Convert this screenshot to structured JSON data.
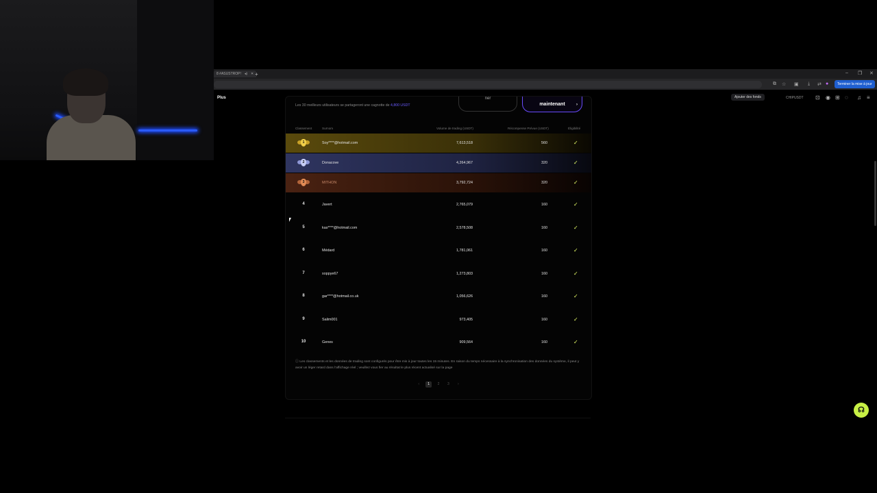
{
  "browser": {
    "tab_title": "8 #ASUSTROP!",
    "update_label": "Terminer la mise à jour"
  },
  "site": {
    "nav_plus": "Plus",
    "deposit_label": "Ajouter des fonds",
    "user_label": "CHIPUSDT"
  },
  "leaderboard": {
    "info_prefix": "Les 30 meilleurs utilisateurs se partageront une cagnotte de ",
    "info_highlight": "4,800 USDT",
    "ghost_button": "ner",
    "main_button": "maintenant",
    "headers": {
      "rank": "Classement",
      "user": "Surnom",
      "volume": "Volume de trading (USDT)",
      "reward": "Récompense Prévue (USDT)",
      "eligibility": "Éligibilité"
    },
    "rows": [
      {
        "rank": "1",
        "user": "Soy****@hotmail.com",
        "volume": "7,613,518",
        "reward": "560"
      },
      {
        "rank": "2",
        "user": "Donacove",
        "volume": "4,264,967",
        "reward": "320"
      },
      {
        "rank": "3",
        "user": "MITHON",
        "volume": "3,792,724",
        "reward": "320"
      },
      {
        "rank": "4",
        "user": "Javert",
        "volume": "2,765,079",
        "reward": "160"
      },
      {
        "rank": "5",
        "user": "kas****@hotmail.com",
        "volume": "2,578,508",
        "reward": "160"
      },
      {
        "rank": "6",
        "user": "Médard",
        "volume": "1,781,061",
        "reward": "160"
      },
      {
        "rank": "7",
        "user": "soppye67",
        "volume": "1,273,803",
        "reward": "160"
      },
      {
        "rank": "8",
        "user": "gar****@hotmail.co.uk",
        "volume": "1,056,626",
        "reward": "160"
      },
      {
        "rank": "9",
        "user": "Salim001",
        "volume": "973,405",
        "reward": "160"
      },
      {
        "rank": "10",
        "user": "Genes",
        "volume": "909,564",
        "reward": "160"
      }
    ],
    "footnote": "Les classements et les données de trading sont configurés pour être mis à jour toutes les 15 minutes. En raison du temps nécessaire à la synchronisation des données du système, il peut y avoir un léger retard dans l'affichage réel ; veuillez vous fier au résultat le plus récent actualisé sur la page",
    "pages": [
      "1",
      "2",
      "3"
    ]
  },
  "colors": {
    "accent": "#6a4bff",
    "check": "#e8ff6a",
    "support": "#c7f045",
    "gold_row": "#4a3c08",
    "silver_row": "#262a4a",
    "bronze_row": "#3a1a10"
  }
}
